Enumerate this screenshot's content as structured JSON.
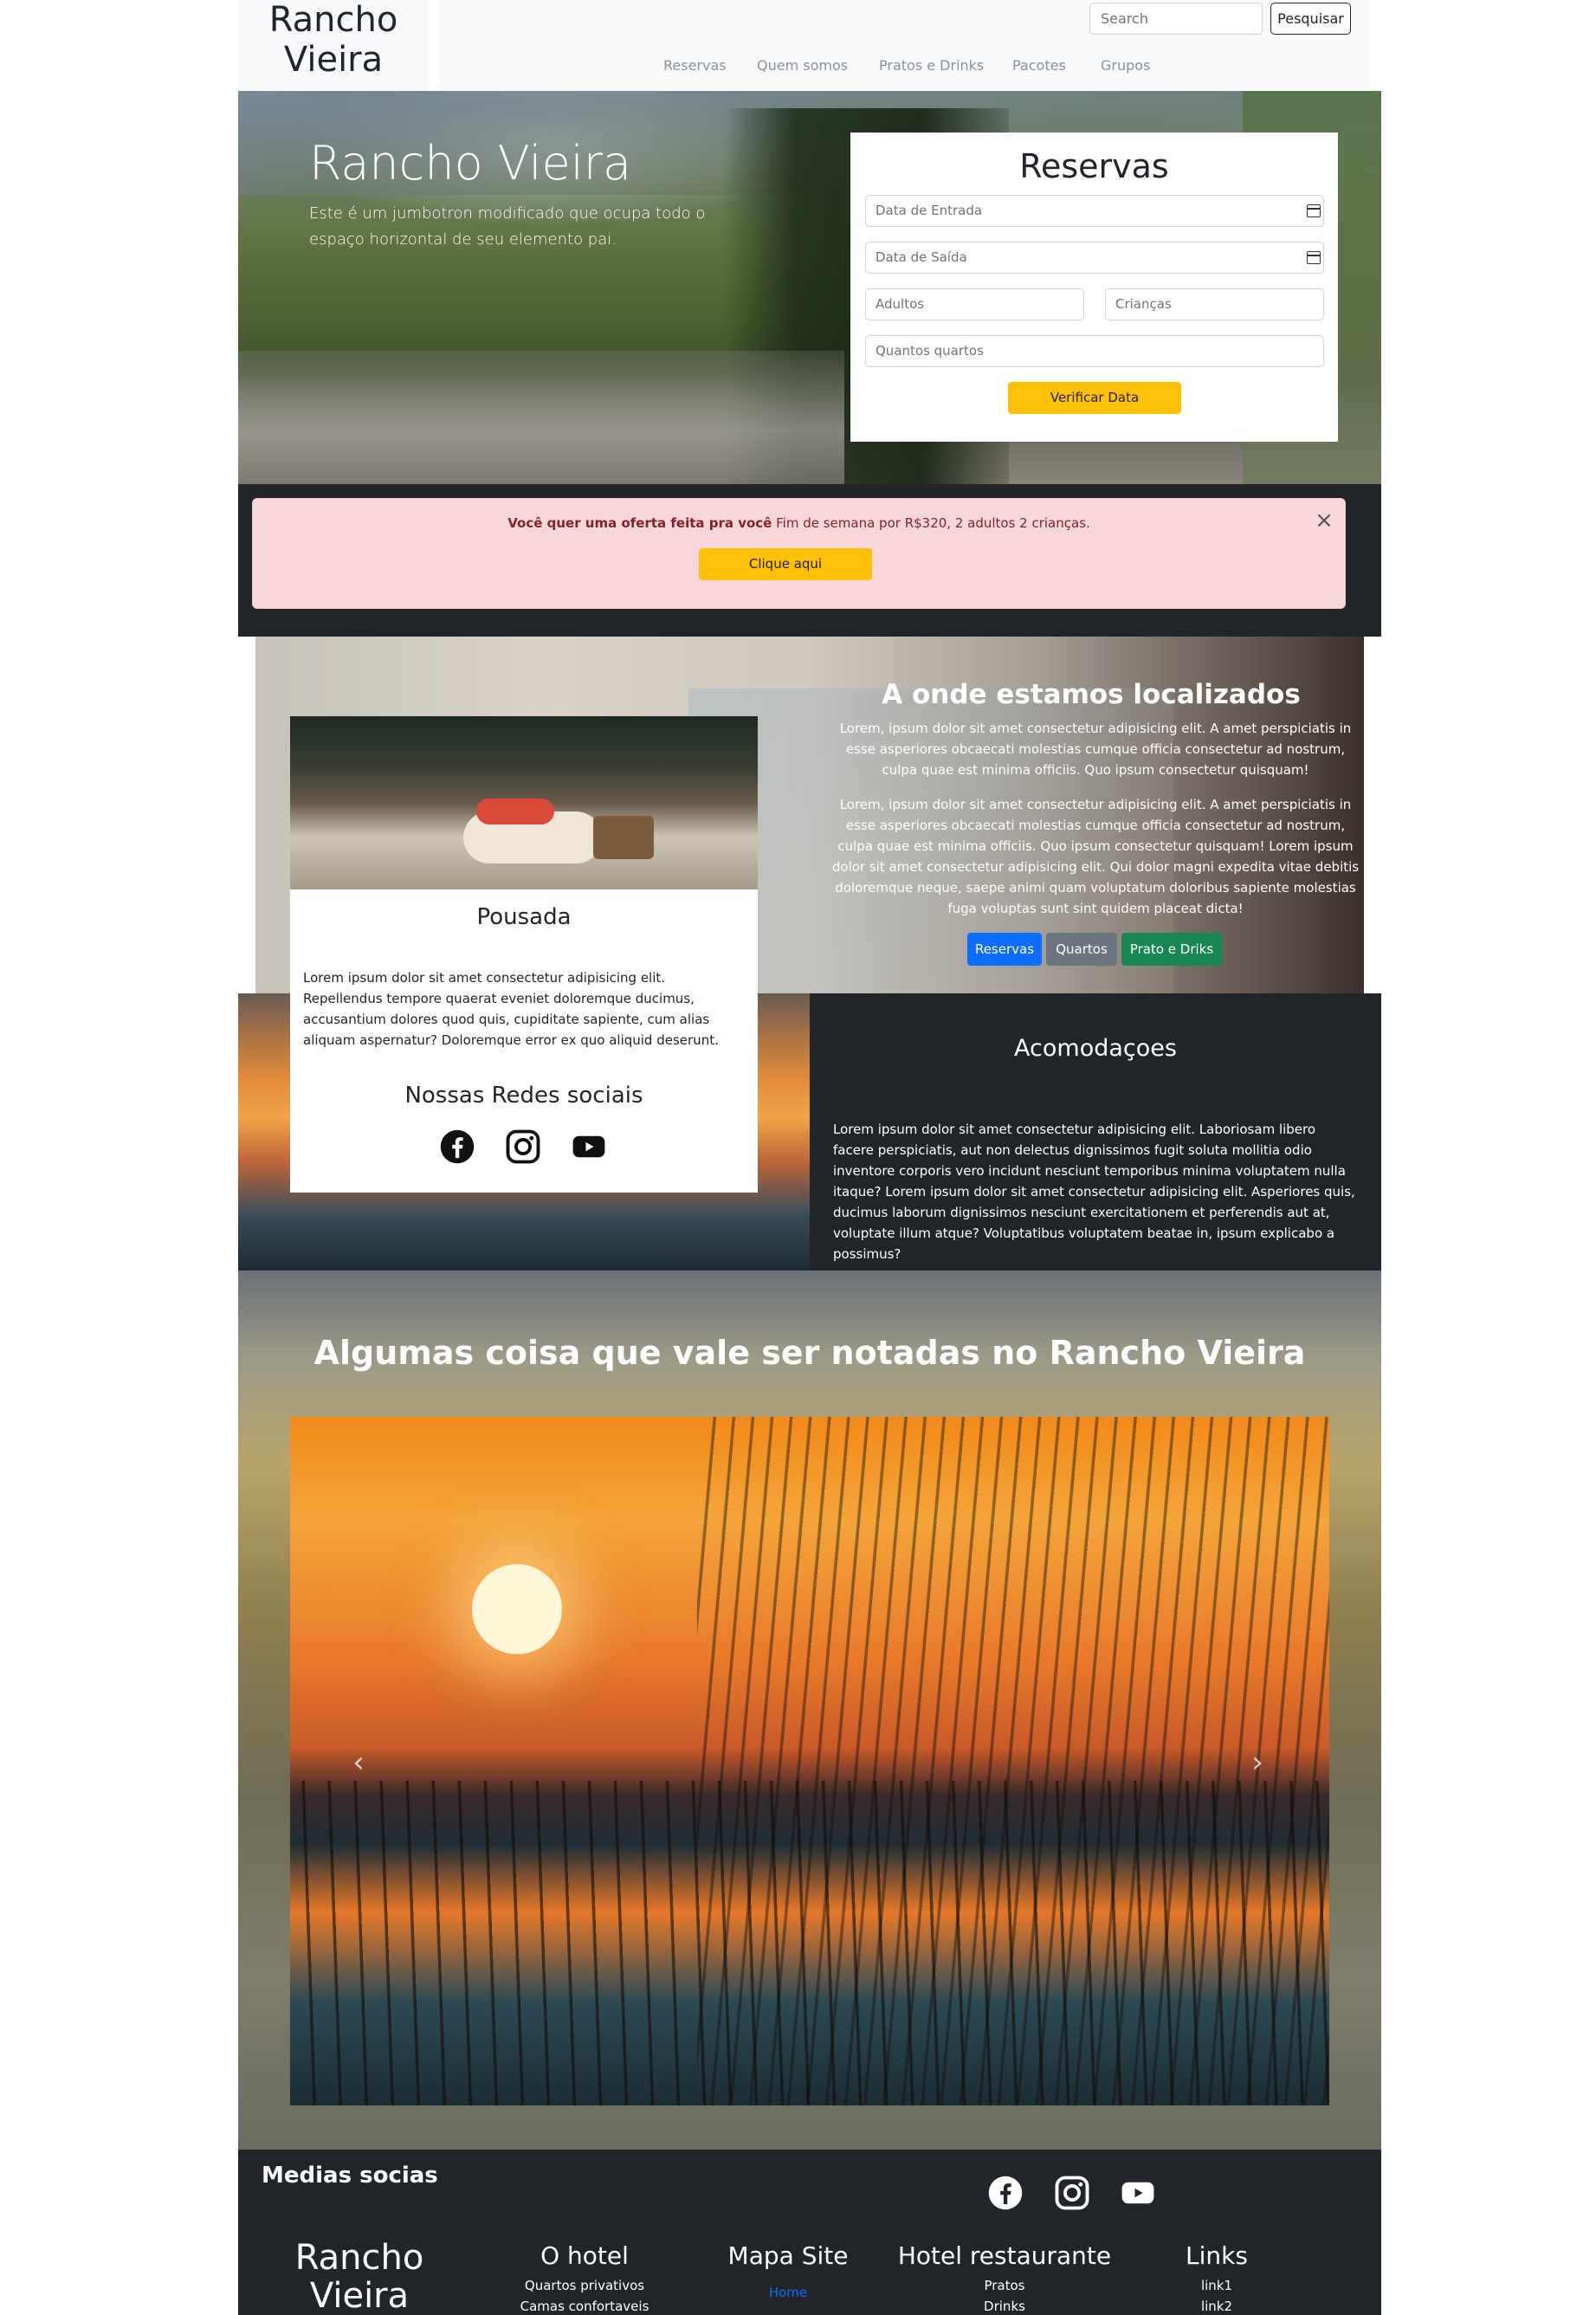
{
  "header": {
    "brand_line1": "Rancho",
    "brand_line2": "Vieira",
    "search_placeholder": "Search",
    "search_button": "Pesquisar",
    "nav": [
      "Reservas",
      "Quem somos",
      "Pratos e Drinks",
      "Pacotes",
      "Grupos"
    ]
  },
  "hero": {
    "title": "Rancho Vieira",
    "subtitle": "Este é um jumbotron modificado que ocupa todo o espaço horizontal de seu elemento pai."
  },
  "reservation": {
    "title": "Reservas",
    "check_in_placeholder": "Data de Entrada",
    "check_out_placeholder": "Data de Saída",
    "adults_placeholder": "Adultos",
    "children_placeholder": "Crianças",
    "rooms_placeholder": "Quantos quartos",
    "submit": "Verificar Data"
  },
  "alert": {
    "bold_text": "Você quer uma oferta feita pra você",
    "text": " Fim de semana por R$320, 2 adultos 2 crianças.",
    "button": "Clique aqui",
    "close_symbol": "×"
  },
  "location": {
    "title": "A onde estamos localizados",
    "paragraph1": "Lorem, ipsum dolor sit amet consectetur adipisicing elit. A amet perspiciatis in esse asperiores obcaecati molestias cumque officia consectetur ad nostrum, culpa quae est minima officiis. Quo ipsum consectetur quisquam!",
    "paragraph2": "Lorem, ipsum dolor sit amet consectetur adipisicing elit. A amet perspiciatis in esse asperiores obcaecati molestias cumque officia consectetur ad nostrum, culpa quae est minima officiis. Quo ipsum consectetur quisquam! Lorem ipsum dolor sit amet consectetur adipisicing elit. Qui dolor magni expedita vitae debitis doloremque neque, saepe animi quam voluptatum doloribus sapiente molestias fuga voluptas sunt sint quidem placeat dicta!",
    "buttons": [
      "Reservas",
      "Quartos",
      "Prato e Driks"
    ]
  },
  "card": {
    "title": "Pousada",
    "text": "Lorem ipsum dolor sit amet consectetur adipisicing elit. Repellendus tempore quaerat eveniet doloremque ducimus, accusantium dolores quod quis, cupiditate sapiente, cum alias aliquam aspernatur? Doloremque error ex quo aliquid deserunt.",
    "social_title": "Nossas Redes sociais"
  },
  "accommodation": {
    "title": "Acomodaçoes",
    "text": "Lorem ipsum dolor sit amet consectetur adipisicing elit. Laboriosam libero facere perspiciatis, aut non delectus dignissimos fugit soluta mollitia odio inventore corporis vero incidunt nesciunt temporibus minima voluptatem nulla itaque? Lorem ipsum dolor sit amet consectetur adipisicing elit. Asperiores quis, ducimus laborum dignissimos nesciunt exercitationem et perferendis aut at, voluptate illum atque? Voluptatibus voluptatem beatae in, ipsum explicabo a possimus?"
  },
  "gallery": {
    "title": "Algumas coisa que vale ser notadas no Rancho Vieira",
    "prev_symbol": "‹",
    "next_symbol": "›"
  },
  "footer": {
    "medias_title": "Medias socias",
    "brand_line1": "Rancho",
    "brand_line2": "Vieira",
    "columns": [
      {
        "title": "O hotel",
        "items": [
          "Quartos privativos",
          "Camas confortaveis"
        ]
      },
      {
        "title": "Mapa Site",
        "items": [
          "Home"
        ]
      },
      {
        "title": "Hotel restaurante",
        "items": [
          "Pratos",
          "Drinks"
        ]
      },
      {
        "title": "Links",
        "items": [
          "link1",
          "link2"
        ]
      }
    ]
  },
  "colors": {
    "warning": "#ffc107",
    "primary": "#0d6efd",
    "secondary": "#6c757d",
    "success": "#198754",
    "dark": "#212529",
    "alert_bg": "#f8d7da"
  },
  "icons": [
    "facebook-icon",
    "instagram-icon",
    "youtube-icon",
    "calendar-icon",
    "close-icon"
  ]
}
